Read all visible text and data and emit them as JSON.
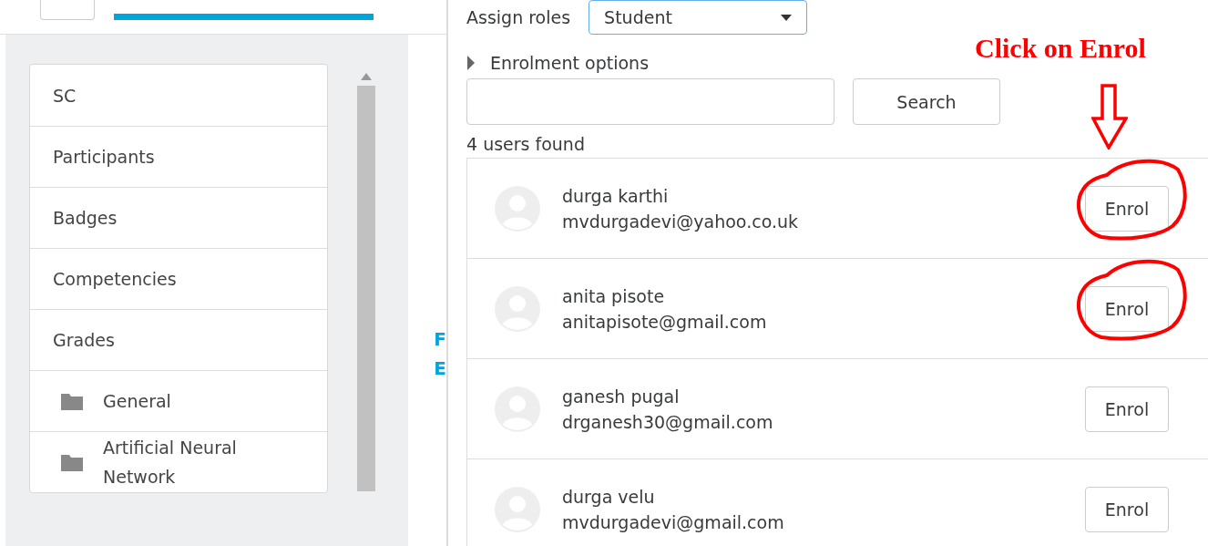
{
  "assign_roles": {
    "label": "Assign roles",
    "value": "Student"
  },
  "enrolment_options": {
    "label": "Enrolment options",
    "expanded": false
  },
  "search": {
    "button": "Search"
  },
  "result_count": "4 users found",
  "users": [
    {
      "name": "durga karthi",
      "email": "mvdurgadevi@yahoo.co.uk",
      "button": "Enrol",
      "circled": true
    },
    {
      "name": "anita pisote",
      "email": "anitapisote@gmail.com",
      "button": "Enrol",
      "circled": true
    },
    {
      "name": "ganesh pugal",
      "email": "drganesh30@gmail.com",
      "button": "Enrol",
      "circled": false
    },
    {
      "name": "durga velu",
      "email": "mvdurgadevi@gmail.com",
      "button": "Enrol",
      "circled": false
    }
  ],
  "sidebar": {
    "items": [
      {
        "label": "SC",
        "kind": "link"
      },
      {
        "label": "Participants",
        "kind": "link"
      },
      {
        "label": "Badges",
        "kind": "link"
      },
      {
        "label": "Competencies",
        "kind": "link"
      },
      {
        "label": "Grades",
        "kind": "link"
      },
      {
        "label": "General",
        "kind": "folder"
      },
      {
        "label": "Artificial Neural Network",
        "kind": "folder"
      }
    ]
  },
  "background_links": [
    "F",
    "E"
  ],
  "annotation": {
    "text": "Click on Enrol"
  }
}
